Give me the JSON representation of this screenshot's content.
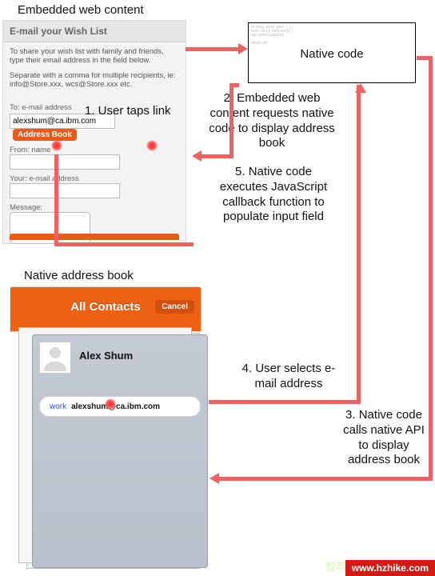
{
  "headings": {
    "embedded": "Embedded web content",
    "nativeCode": "Native code",
    "nativeAddrBook": "Native address book"
  },
  "steps": {
    "s1": "1. User taps link",
    "s2": "2. Embedded web content requests native code to display address book",
    "s3": "3. Native code calls native API to display address book",
    "s4": "4. User selects e-mail address",
    "s5": "5. Native code executes JavaScript callback function to populate input field"
  },
  "webForm": {
    "title": "E-mail your Wish List",
    "intro": "To share your wish list with family and friends, type their email address in the field below.",
    "intro2": "Separate with a comma for multiple recipients, ie: info@Store.xxx, wcs@Store.xxx etc.",
    "toLabel": "To: e-mail address",
    "toValue": "alexshum@ca.ibm.com",
    "addressBookBtn": "Address Book",
    "fromLabel": "From: name",
    "yourEmailLabel": "Your: e-mail address",
    "messageLabel": "Message:"
  },
  "addressBook": {
    "title": "All Contacts",
    "cancel": "Cancel",
    "contactName": "Alex Shum",
    "contactTag": "work",
    "contactEmail": "alexshum@ca.ibm.com"
  },
  "watermarks": {
    "left": "智可网",
    "right": "www.hzhike.com"
  },
  "chart_data": {
    "type": "flow-diagram",
    "nodes": [
      {
        "id": "web",
        "label": "Embedded web content"
      },
      {
        "id": "native",
        "label": "Native code"
      },
      {
        "id": "addrbook",
        "label": "Native address book"
      }
    ],
    "edges": [
      {
        "from": "web",
        "to": "web",
        "label": "1. User taps link"
      },
      {
        "from": "web",
        "to": "native",
        "label": "2. Embedded web content requests native code to display address book"
      },
      {
        "from": "native",
        "to": "addrbook",
        "label": "3. Native code calls native API to display address book"
      },
      {
        "from": "addrbook",
        "to": "native",
        "label": "4. User selects e-mail address"
      },
      {
        "from": "native",
        "to": "web",
        "label": "5. Native code executes JavaScript callback function to populate input field"
      }
    ]
  }
}
